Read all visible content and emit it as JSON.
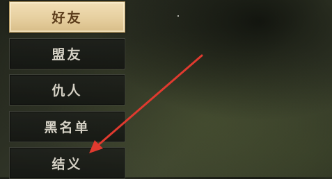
{
  "social_menu": {
    "items": [
      {
        "label": "好友",
        "active": true
      },
      {
        "label": "盟友",
        "active": false
      },
      {
        "label": "仇人",
        "active": false
      },
      {
        "label": "黑名单",
        "active": false
      },
      {
        "label": "结义",
        "active": false
      }
    ]
  },
  "annotation": {
    "icon": "arrow-icon",
    "color": "#e03a2f"
  },
  "colors": {
    "active_tab_bg": "#e6cf9f",
    "active_tab_text": "#5b3c1a",
    "tab_text": "#d6d2c6"
  }
}
